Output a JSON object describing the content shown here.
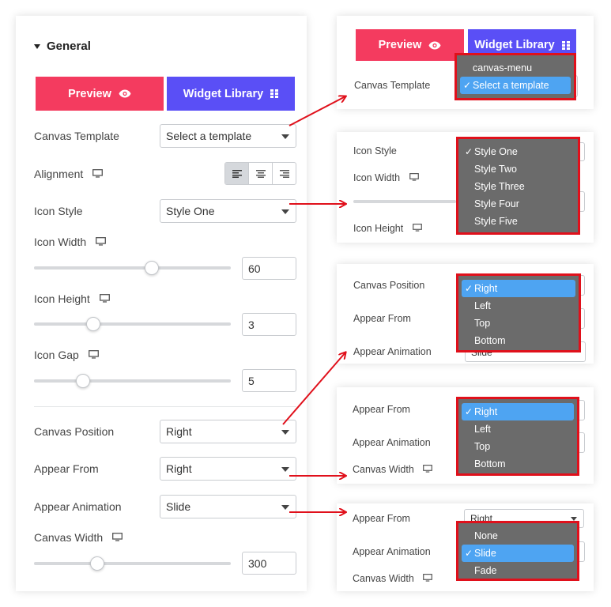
{
  "panel": {
    "section_title": "General",
    "preview_label": "Preview",
    "widget_library_label": "Widget Library",
    "canvas_template_label": "Canvas Template",
    "canvas_template_value": "Select a template",
    "alignment_label": "Alignment",
    "icon_style_label": "Icon Style",
    "icon_style_value": "Style One",
    "icon_width_label": "Icon Width",
    "icon_width_value": "60",
    "icon_width_level": 0.6,
    "icon_height_label": "Icon Height",
    "icon_height_value": "3",
    "icon_height_level": 0.3,
    "icon_gap_label": "Icon Gap",
    "icon_gap_value": "5",
    "icon_gap_level": 0.25,
    "canvas_position_label": "Canvas Position",
    "canvas_position_value": "Right",
    "appear_from_label": "Appear From",
    "appear_from_value": "Right",
    "appear_animation_label": "Appear Animation",
    "appear_animation_value": "Slide",
    "canvas_width_label": "Canvas Width",
    "canvas_width_value": "300",
    "canvas_width_level": 0.32
  },
  "callout1": {
    "preview_label": "Preview",
    "widget_library_label": "Widget Library",
    "canvas_template_label": "Canvas Template",
    "options": [
      "canvas-menu",
      "Select a template"
    ],
    "selected_index": 1
  },
  "callout2": {
    "icon_style_label": "Icon Style",
    "icon_width_label": "Icon Width",
    "icon_height_label": "Icon Height",
    "options": [
      "Style One",
      "Style Two",
      "Style Three",
      "Style Four",
      "Style Five"
    ],
    "selected_index": 0
  },
  "callout3": {
    "canvas_position_label": "Canvas Position",
    "appear_from_label": "Appear From",
    "appear_animation_label": "Appear Animation",
    "appear_animation_value": "Slide",
    "options": [
      "Right",
      "Left",
      "Top",
      "Bottom"
    ],
    "selected_index": 0
  },
  "callout4": {
    "appear_from_label": "Appear From",
    "appear_animation_label": "Appear Animation",
    "canvas_width_label": "Canvas Width",
    "options": [
      "Right",
      "Left",
      "Top",
      "Bottom"
    ],
    "selected_index": 0
  },
  "callout5": {
    "appear_from_label": "Appear From",
    "appear_from_value": "Right",
    "appear_animation_label": "Appear Animation",
    "canvas_width_label": "Canvas Width",
    "options": [
      "None",
      "Slide",
      "Fade"
    ],
    "selected_index": 1
  },
  "colors": {
    "preview_button": "#f43b5f",
    "widget_library_button": "#5a4ff6",
    "highlight_border": "#e0101b",
    "dropdown_bg": "#6b6b6b",
    "option_selected": "#4ea4f2",
    "annotation_arrow": "#e0101b"
  },
  "icons": [
    "caret-down-icon",
    "eye-icon",
    "grid-icon",
    "monitor-icon",
    "align-left-icon",
    "align-center-icon",
    "align-right-icon",
    "checkmark-icon"
  ]
}
